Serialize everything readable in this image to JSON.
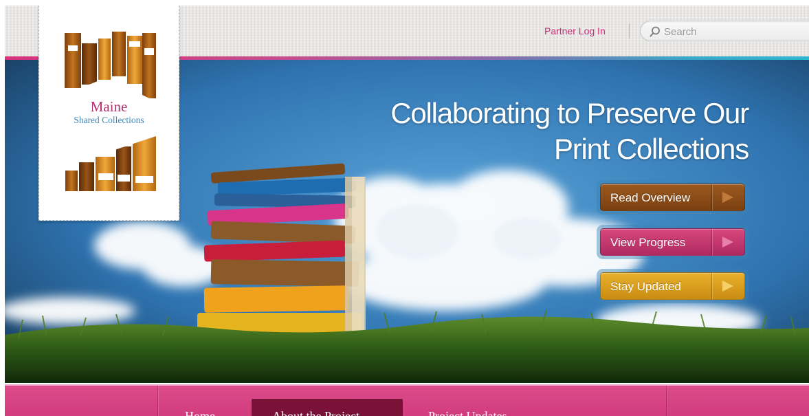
{
  "header": {
    "partner_login": "Partner Log In",
    "search": {
      "placeholder": "Search"
    }
  },
  "logo": {
    "title": "Maine",
    "subtitle": "Shared Collections"
  },
  "hero": {
    "headline_line1": "Collaborating to Preserve Our",
    "headline_line2": "Print Collections",
    "buttons": [
      {
        "label": "Read Overview",
        "color": "#8b4b18"
      },
      {
        "label": "View Progress",
        "color": "#c5356f"
      },
      {
        "label": "Stay Updated",
        "color": "#dca01f"
      }
    ]
  },
  "nav": {
    "items": [
      {
        "label": "Home"
      },
      {
        "label": "About the Project",
        "active": true
      },
      {
        "label": "Project Updates"
      }
    ]
  },
  "colors": {
    "accent_pink": "#cc2a77",
    "stripe_blue": "#2fb6d0",
    "nav_pink": "#d8437f",
    "nav_active": "#7a1238"
  }
}
